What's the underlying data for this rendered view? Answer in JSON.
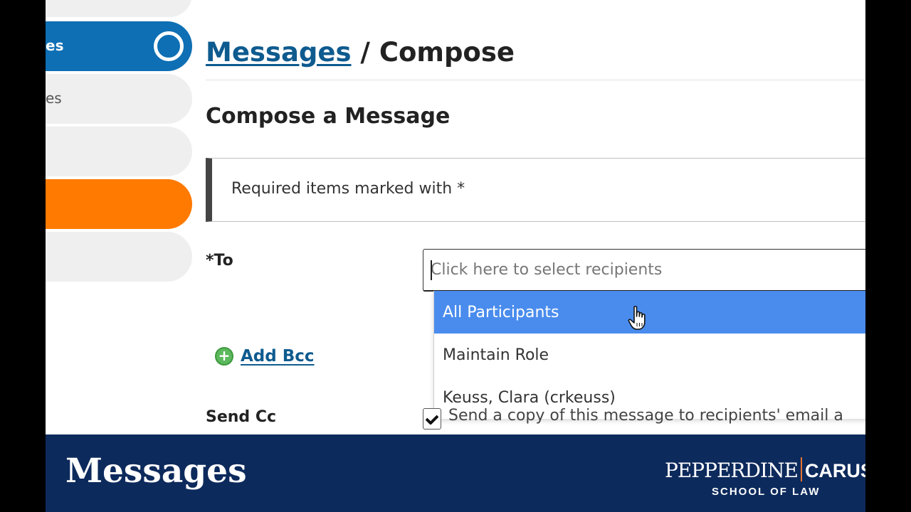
{
  "sidebar": {
    "items": [
      {
        "label": ""
      },
      {
        "label": "es"
      },
      {
        "label": "es"
      },
      {
        "label": ""
      },
      {
        "label": ""
      },
      {
        "label": ""
      }
    ]
  },
  "header": {
    "breadcrumb_link": "Messages",
    "breadcrumb_separator": " / ",
    "breadcrumb_current": "Compose"
  },
  "main": {
    "heading": "Compose a Message",
    "notice": "Required items marked with *",
    "to": {
      "label": "*To",
      "placeholder": "Click here to select recipients",
      "value": ""
    },
    "recipients_dropdown": {
      "options": [
        "All Participants",
        "Maintain Role",
        "Keuss, Clara (crkeuss)"
      ],
      "highlighted": "All Participants"
    },
    "add_bcc": "Add Bcc",
    "send_cc": {
      "label": "Send Cc",
      "text": "Send a copy of this message to recipients' email a"
    }
  },
  "banner": {
    "title": "Messages",
    "logo_primary": "PEPPERDINE",
    "logo_secondary": "CARUSO",
    "logo_sub": "SCHOOL OF LAW"
  },
  "colors": {
    "sidebar_active": "#0e6fb4",
    "sidebar_orange": "#ff7a00",
    "dropdown_highlight": "#4a8ced",
    "link": "#0e5b8f",
    "banner_bg": "#0d2a5c",
    "logo_divider": "#e8732e"
  },
  "icons": [
    "ring-icon",
    "plus-circle-icon",
    "checkbox-check-icon",
    "hand-cursor-icon"
  ]
}
